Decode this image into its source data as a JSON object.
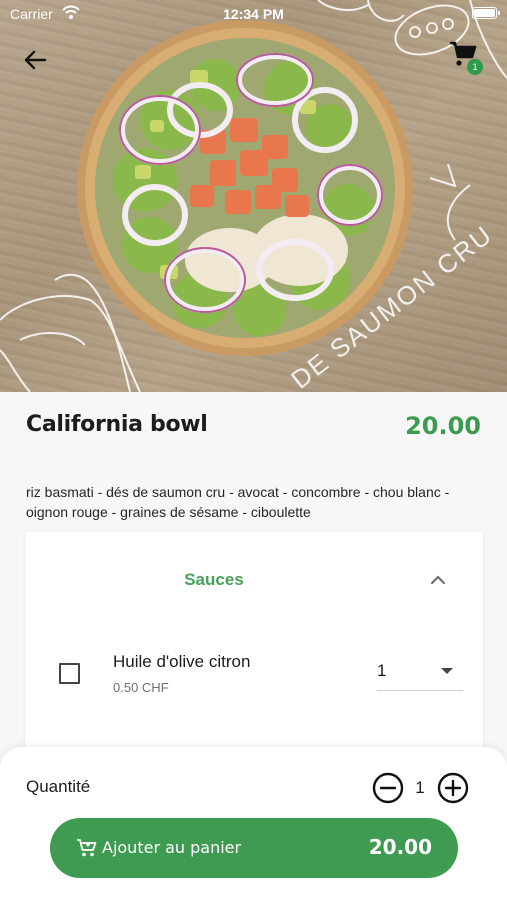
{
  "status_bar": {
    "carrier": "Carrier",
    "time": "12:34 PM"
  },
  "hero": {
    "image": "poke-bowl-photo",
    "decor_text": "DE SAUMON CRU",
    "cart_badge": "1"
  },
  "product": {
    "name": "California bowl",
    "price": "20.00",
    "description": "riz basmati - dés de saumon cru - avocat - concombre - chou blanc - oignon rouge - graines de sésame - ciboulette"
  },
  "options": {
    "group_title": "Sauces",
    "items": [
      {
        "name": "Huile d'olive citron",
        "price": "0.50 CHF",
        "quantity": "1",
        "checked": false
      }
    ]
  },
  "bottom_bar": {
    "quantity_label": "Quantité",
    "quantity_value": "1",
    "add_button_label": "Ajouter au panier",
    "add_button_total": "20.00"
  },
  "colors": {
    "accent_green": "#3f9b52",
    "price_green": "#3c9b4f"
  },
  "icons": [
    "back-arrow-icon",
    "cart-icon",
    "chevron-up-icon",
    "checkbox-icon",
    "dropdown-arrow-icon",
    "minus-circle-icon",
    "plus-circle-icon",
    "add-to-cart-icon",
    "wifi-icon",
    "battery-icon"
  ]
}
